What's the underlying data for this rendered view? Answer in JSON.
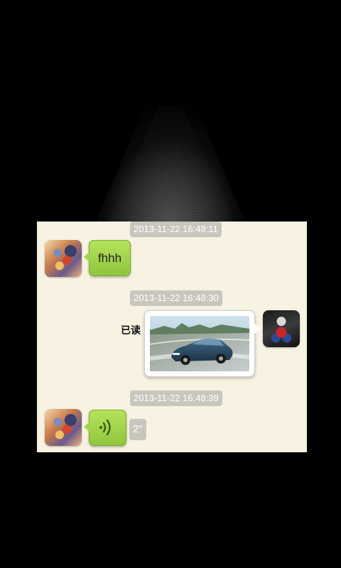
{
  "chat": {
    "messages": [
      {
        "timestamp": "2013-11-22 16:48:11",
        "sender": "contact",
        "type": "text",
        "text": "fhhh"
      },
      {
        "timestamp": "2013-11-22 16:48:30",
        "sender": "me",
        "type": "image",
        "read_status": "已读",
        "image_subject": "car-photo"
      },
      {
        "timestamp": "2013-11-22 16:48:39",
        "sender": "contact",
        "type": "voice",
        "duration": "2\""
      }
    ]
  },
  "colors": {
    "screen_background": "#000000",
    "chat_background": "#f7f2e1",
    "timestamp_badge": "#c9c6bd",
    "incoming_bubble": "#a4d34c",
    "outgoing_bubble": "#ffffff"
  },
  "icons": {
    "voice": "voice-wave-icon",
    "contact_avatar": "contact-avatar-mecha",
    "my_avatar": "my-avatar-gundam"
  }
}
